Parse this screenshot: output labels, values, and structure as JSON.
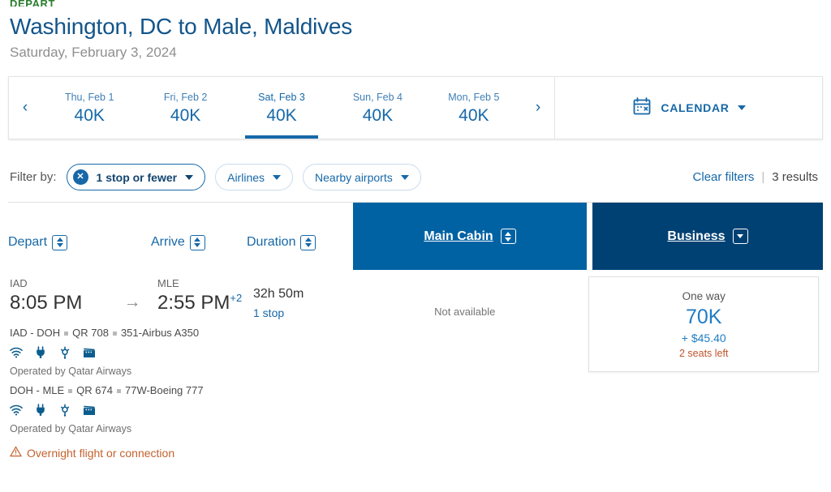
{
  "header": {
    "eyebrow": "DEPART",
    "route_title": "Washington, DC to Male, Maldives",
    "date_subtitle": "Saturday, February 3, 2024"
  },
  "date_strip": {
    "prev_label": "‹",
    "next_label": "›",
    "days": [
      {
        "label": "Thu, Feb 1",
        "price": "40K",
        "selected": false
      },
      {
        "label": "Fri, Feb 2",
        "price": "40K",
        "selected": false
      },
      {
        "label": "Sat, Feb 3",
        "price": "40K",
        "selected": true
      },
      {
        "label": "Sun, Feb 4",
        "price": "40K",
        "selected": false
      },
      {
        "label": "Mon, Feb 5",
        "price": "40K",
        "selected": false
      }
    ],
    "calendar": {
      "icon": "calendar-icon",
      "label": "CALENDAR",
      "caret": "chevron-down-icon"
    }
  },
  "filters": {
    "label": "Filter by:",
    "pills": [
      {
        "label": "1 stop or fewer",
        "active": true,
        "remove_icon": "x-circle-icon"
      },
      {
        "label": "Airlines",
        "active": false
      },
      {
        "label": "Nearby airports",
        "active": false
      }
    ],
    "clear_label": "Clear filters",
    "separator": "|",
    "results": "3 results"
  },
  "sort_headers": [
    {
      "label": "Depart",
      "icon": "sort-updown-icon"
    },
    {
      "label": "Arrive",
      "icon": "sort-updown-icon"
    },
    {
      "label": "Duration",
      "icon": "sort-updown-icon"
    }
  ],
  "cabins": [
    {
      "label": "Main Cabin",
      "icon": "sort-updown-icon",
      "color": "#0062a3"
    },
    {
      "label": "Business",
      "icon": "chevron-down-icon",
      "color": "#004174"
    }
  ],
  "result": {
    "depart": {
      "airport": "IAD",
      "time": "8:05 PM"
    },
    "arrive": {
      "airport": "MLE",
      "time": "2:55 PM",
      "plus_days": "+2"
    },
    "arrow_icon": "arrow-right-icon",
    "duration": "32h 50m",
    "stops": "1 stop",
    "segments": [
      {
        "route": "IAD - DOH",
        "flight_number": "QR 708",
        "aircraft": "351-Airbus A350",
        "amenities": [
          "wifi-icon",
          "power-outlet-icon",
          "usb-port-icon",
          "entertainment-icon"
        ],
        "operated_by": "Operated by Qatar Airways"
      },
      {
        "route": "DOH - MLE",
        "flight_number": "QR 674",
        "aircraft": "77W-Boeing 777",
        "amenities": [
          "wifi-icon",
          "power-outlet-icon",
          "usb-port-icon",
          "entertainment-icon"
        ],
        "operated_by": "Operated by Qatar Airways"
      }
    ],
    "overnight_notice": {
      "icon": "warning-triangle-icon",
      "text": "Overnight flight or connection"
    },
    "fares": {
      "main_cabin": {
        "status": "Not available"
      },
      "business": {
        "trip_type": "One way",
        "miles": "70K",
        "cash": "+ $45.40",
        "seats_left": "2 seats left"
      }
    }
  }
}
